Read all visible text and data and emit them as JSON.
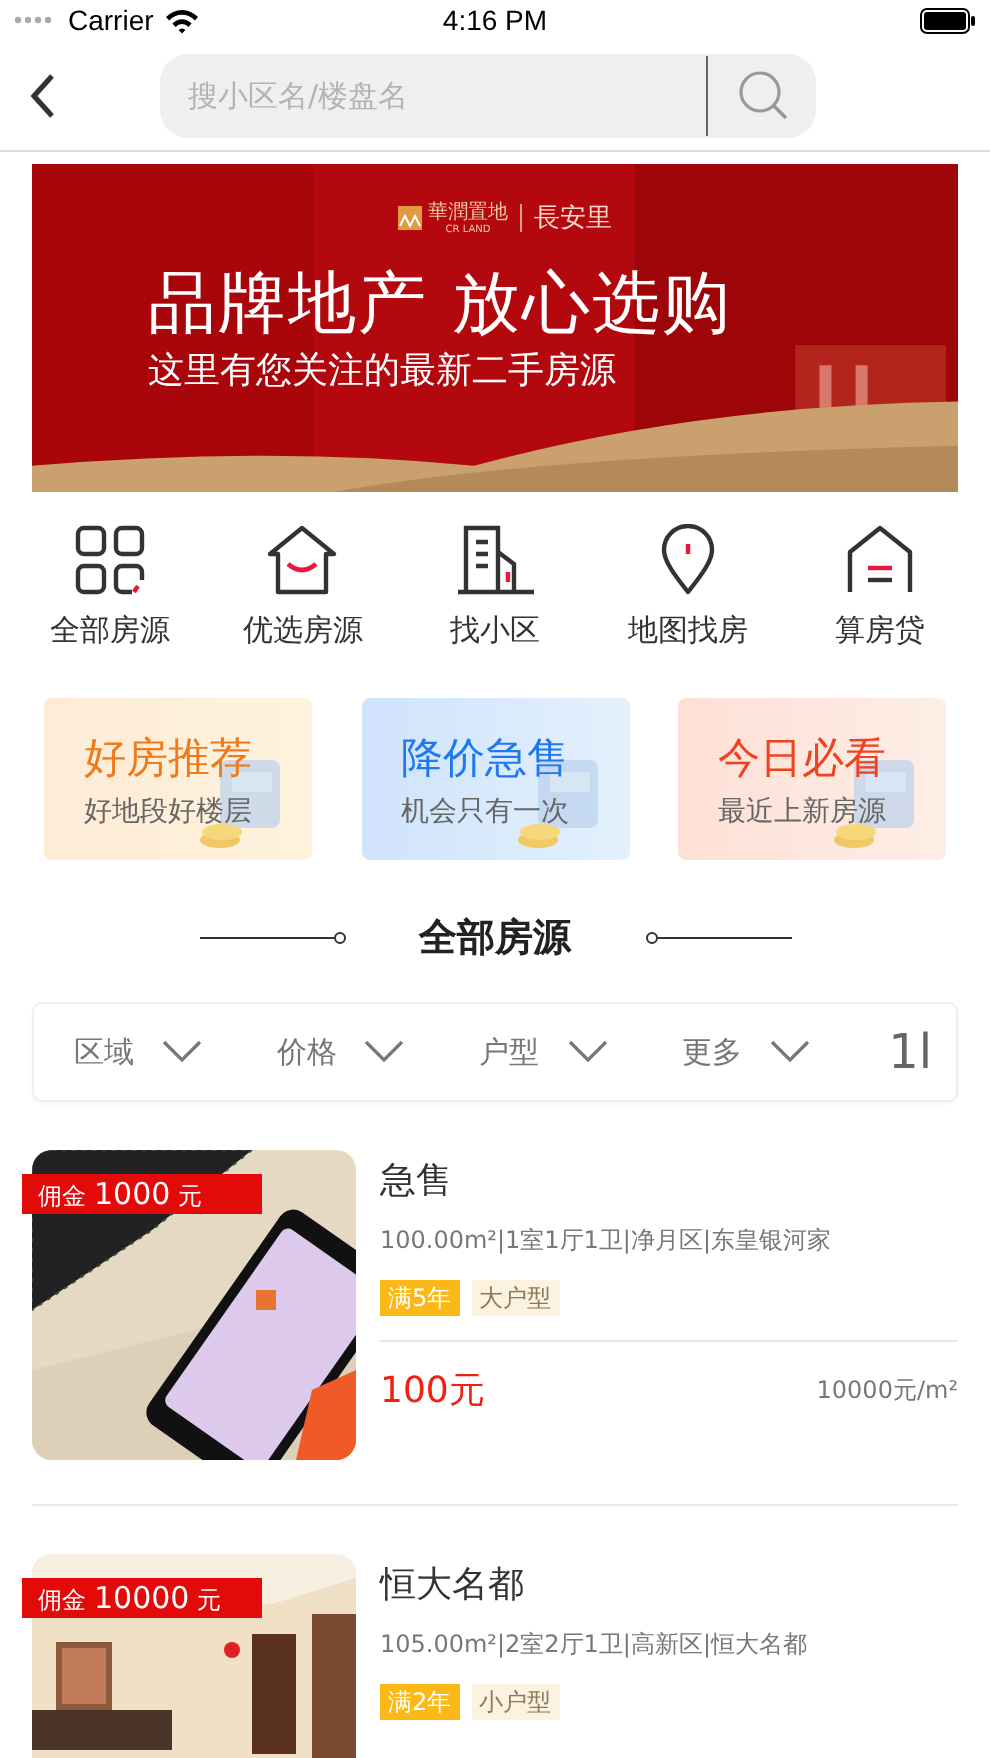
{
  "status_bar": {
    "carrier": "Carrier",
    "time": "4:16 PM"
  },
  "search": {
    "placeholder": "搜小区名/楼盘名"
  },
  "banner": {
    "brand": "華潤置地",
    "brand_sub": "CR LAND",
    "project": "長安里",
    "headline": "品牌地产 放心选购",
    "subtitle": "这里有您关注的最新二手房源"
  },
  "categories": [
    {
      "kind": "grid",
      "label": "全部房源"
    },
    {
      "kind": "house",
      "label": "优选房源"
    },
    {
      "kind": "building",
      "label": "找小区"
    },
    {
      "kind": "pin",
      "label": "地图找房"
    },
    {
      "kind": "loan",
      "label": "算房贷"
    }
  ],
  "promos": [
    {
      "kind": "orange",
      "title": "好房推荐",
      "subtitle": "好地段好楼层"
    },
    {
      "kind": "blue",
      "title": "降价急售",
      "subtitle": "机会只有一次"
    },
    {
      "kind": "red",
      "title": "今日必看",
      "subtitle": "最近上新房源"
    }
  ],
  "section_title": "全部房源",
  "filters": [
    {
      "label": "区域"
    },
    {
      "label": "价格"
    },
    {
      "label": "户型"
    },
    {
      "label": "更多"
    }
  ],
  "sort_icon": "1l",
  "listings": [
    {
      "kind": "phone",
      "commission_label": "佣金",
      "commission": "1000",
      "commission_unit": "元",
      "title": "急售",
      "details": "100.00m²|1室1厅1卫|净月区|东皇银河家",
      "tags": [
        {
          "text": "满5年",
          "kind": "age"
        },
        {
          "text": "大户型",
          "kind": "type"
        }
      ],
      "price": "100元",
      "unit_price": "10000元/m²"
    },
    {
      "kind": "room",
      "commission_label": "佣金",
      "commission": "10000",
      "commission_unit": "元",
      "title": "恒大名都",
      "details": "105.00m²|2室2厅1卫|高新区|恒大名都",
      "tags": [
        {
          "text": "满2年",
          "kind": "age"
        },
        {
          "text": "小户型",
          "kind": "type"
        }
      ]
    }
  ]
}
